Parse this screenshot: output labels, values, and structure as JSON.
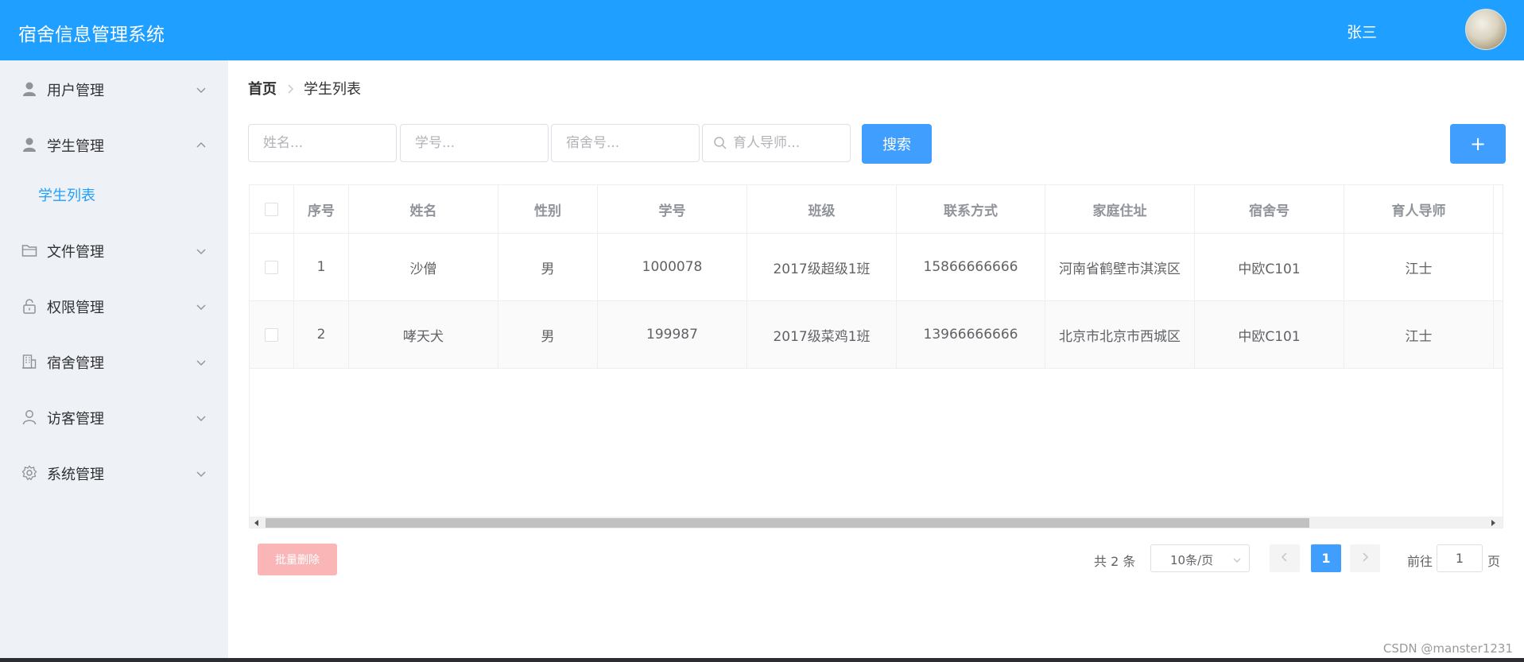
{
  "header": {
    "title": "宿舍信息管理系统",
    "user_name": "张三"
  },
  "sidebar": {
    "items": [
      {
        "label": "用户管理",
        "icon": "user-icon",
        "expanded": false
      },
      {
        "label": "学生管理",
        "icon": "user-icon",
        "expanded": true
      },
      {
        "label": "文件管理",
        "icon": "folder-icon",
        "expanded": false
      },
      {
        "label": "权限管理",
        "icon": "lock-icon",
        "expanded": false
      },
      {
        "label": "宿舍管理",
        "icon": "building-icon",
        "expanded": false
      },
      {
        "label": "访客管理",
        "icon": "person-outline-icon",
        "expanded": false
      },
      {
        "label": "系统管理",
        "icon": "gear-icon",
        "expanded": false
      }
    ],
    "sub_item": {
      "label": "学生列表"
    }
  },
  "breadcrumb": {
    "home": "首页",
    "current": "学生列表"
  },
  "search": {
    "name_placeholder": "姓名...",
    "student_no_placeholder": "学号...",
    "dorm_placeholder": "宿舍号...",
    "tutor_placeholder": "育人导师...",
    "search_label": "搜索",
    "add_label": "+"
  },
  "table": {
    "headers": [
      "序号",
      "姓名",
      "性别",
      "学号",
      "班级",
      "联系方式",
      "家庭住址",
      "宿舍号",
      "育人导师"
    ],
    "rows": [
      [
        "1",
        "沙僧",
        "男",
        "1000078",
        "2017级超级1班",
        "15866666666",
        "河南省鹤壁市淇滨区",
        "中欧C101",
        "江士"
      ],
      [
        "2",
        "哮天犬",
        "男",
        "199987",
        "2017级菜鸡1班",
        "13966666666",
        "北京市北京市西城区",
        "中欧C101",
        "江士"
      ]
    ]
  },
  "footer": {
    "batch_delete_label": "批量删除",
    "total_text": "共 2 条",
    "page_size": "10条/页",
    "current_page": "1",
    "goto_label": "前往",
    "goto_value": "1",
    "goto_unit": "页"
  },
  "watermark": "CSDN @manster1231",
  "colors": {
    "header_bg": "#1f9fff",
    "primary": "#409eff",
    "sidebar_bg": "#eef1f6",
    "danger_light": "#fab6b6"
  }
}
